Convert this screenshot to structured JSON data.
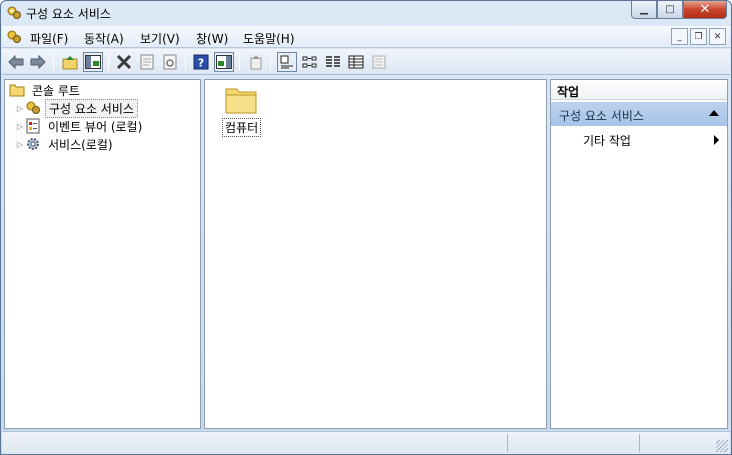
{
  "window": {
    "title": "구성 요소 서비스",
    "caption": {
      "minimize": "▁",
      "maximize": "□",
      "close": "✕"
    }
  },
  "menu": {
    "items": [
      "파일(F)",
      "동작(A)",
      "보기(V)",
      "창(W)",
      "도움말(H)"
    ],
    "mdi": {
      "minimize": "_",
      "restore": "❐",
      "close": "✕"
    }
  },
  "toolbar": {
    "icons": [
      "back-arrow-icon",
      "forward-arrow-icon",
      "up-folder-icon",
      "show-hide-tree-icon",
      "delete-icon",
      "properties-icon",
      "refresh-icon",
      "help-icon",
      "show-hide-action-pane-icon",
      "export-icon",
      "large-icons-view-icon",
      "small-icons-view-icon",
      "list-view-icon",
      "detail-view-icon",
      "properties-view-icon"
    ]
  },
  "tree": {
    "root": "콘솔 루트",
    "items": [
      "구성 요소 서비스",
      "이벤트 뷰어 (로컬)",
      "서비스(로컬)"
    ],
    "selected_index": 0
  },
  "content": {
    "items": [
      "컴퓨터"
    ]
  },
  "actions": {
    "header": "작업",
    "section": "구성 요소 서비스",
    "items": [
      "기타 작업"
    ]
  },
  "colors": {
    "window_border": "#5b7597",
    "section_bg": "#bcd3ee",
    "close_red": "#c7452b",
    "folder_yellow": "#f5d76e"
  }
}
